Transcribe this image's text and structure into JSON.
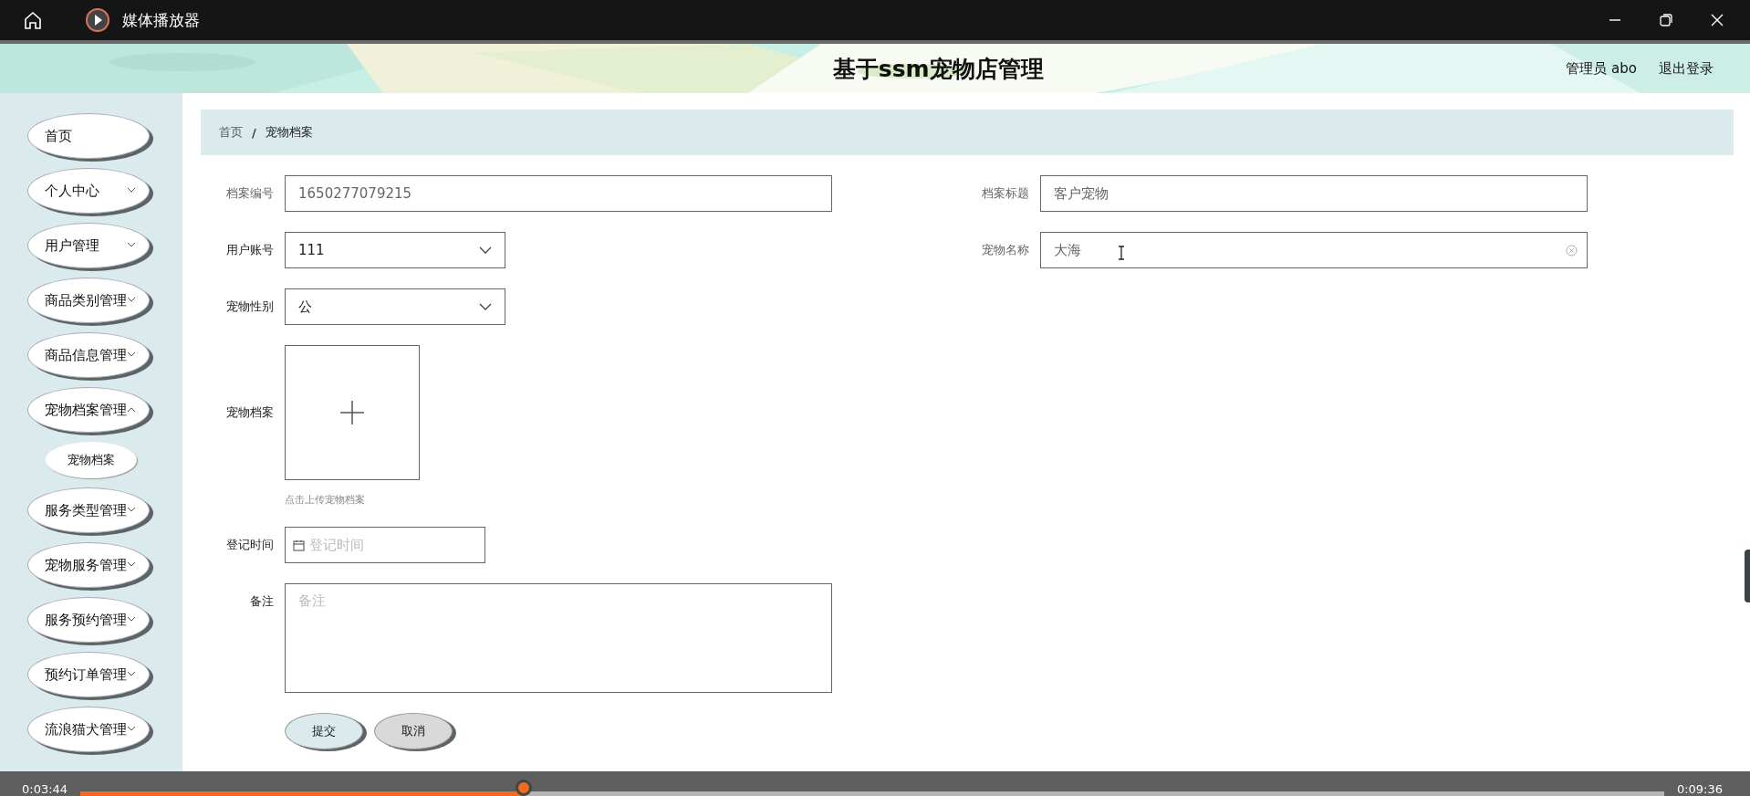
{
  "player": {
    "title": "媒体播放器",
    "elapsed": "0:03:44",
    "duration": "0:09:36",
    "level": 0.28
  },
  "header": {
    "title": "基于ssm宠物店管理",
    "user": "管理员 abo",
    "logout": "退出登录"
  },
  "sidebar": {
    "items": [
      {
        "label": "首页"
      },
      {
        "label": "个人中心",
        "expanded": false
      },
      {
        "label": "用户管理",
        "expanded": false
      },
      {
        "label": "商品类别管理",
        "expanded": false
      },
      {
        "label": "商品信息管理",
        "expanded": false
      },
      {
        "label": "宠物档案管理",
        "expanded": true,
        "children": [
          {
            "label": "宠物档案"
          }
        ]
      },
      {
        "label": "服务类型管理",
        "expanded": false
      },
      {
        "label": "宠物服务管理",
        "expanded": false
      },
      {
        "label": "服务预约管理",
        "expanded": false
      },
      {
        "label": "预约订单管理",
        "expanded": false
      },
      {
        "label": "流浪猫犬管理",
        "expanded": false
      }
    ]
  },
  "breadcrumb": {
    "separator": "/",
    "items": [
      "首页",
      "宠物档案"
    ]
  },
  "form": {
    "left_fields": [
      {
        "kind": "text",
        "label": "档案编号",
        "value": "1650277079215"
      },
      {
        "kind": "select",
        "label": "用户账号",
        "value": "111"
      },
      {
        "kind": "select",
        "label": "宠物性别",
        "value": "公"
      },
      {
        "kind": "upload",
        "label": "宠物档案",
        "hint": "点击上传宠物档案"
      },
      {
        "kind": "date",
        "label": "登记时间",
        "placeholder": "登记时间"
      },
      {
        "kind": "textarea",
        "label": "备注",
        "placeholder": "备注"
      }
    ],
    "right_fields": [
      {
        "kind": "text",
        "label": "档案标题",
        "value": "客户宠物"
      },
      {
        "kind": "text",
        "label": "宠物名称",
        "value": "大海",
        "clearable": true
      }
    ],
    "buttons": [
      {
        "label": "提交",
        "kind": "primary"
      },
      {
        "label": "取消",
        "kind": "cancel"
      }
    ]
  }
}
